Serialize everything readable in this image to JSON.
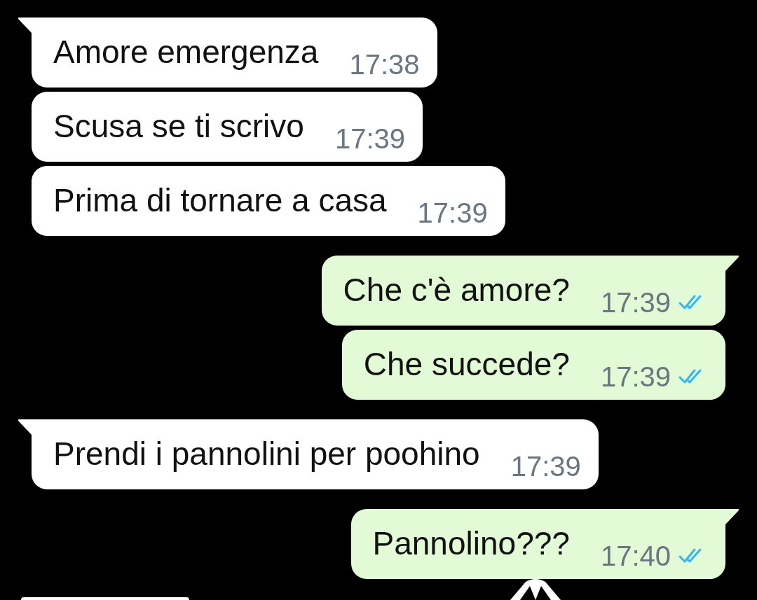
{
  "messages": [
    {
      "sent": false,
      "tail": true,
      "text": "Amore emergenza",
      "time": "17:38"
    },
    {
      "sent": false,
      "tail": false,
      "text": "Scusa se ti scrivo",
      "time": "17:39"
    },
    {
      "sent": false,
      "tail": false,
      "text": "Prima di tornare a casa",
      "time": "17:39"
    },
    {
      "sent": true,
      "tail": true,
      "text": "Che c'è amore?",
      "time": "17:39",
      "read": true
    },
    {
      "sent": true,
      "tail": false,
      "text": "Che succede?",
      "time": "17:39",
      "read": true
    },
    {
      "sent": false,
      "tail": true,
      "text": "Prendi i pannolini per poohino",
      "time": "17:39"
    },
    {
      "sent": true,
      "tail": true,
      "text": "Pannolino???",
      "time": "17:40",
      "read": true
    }
  ]
}
